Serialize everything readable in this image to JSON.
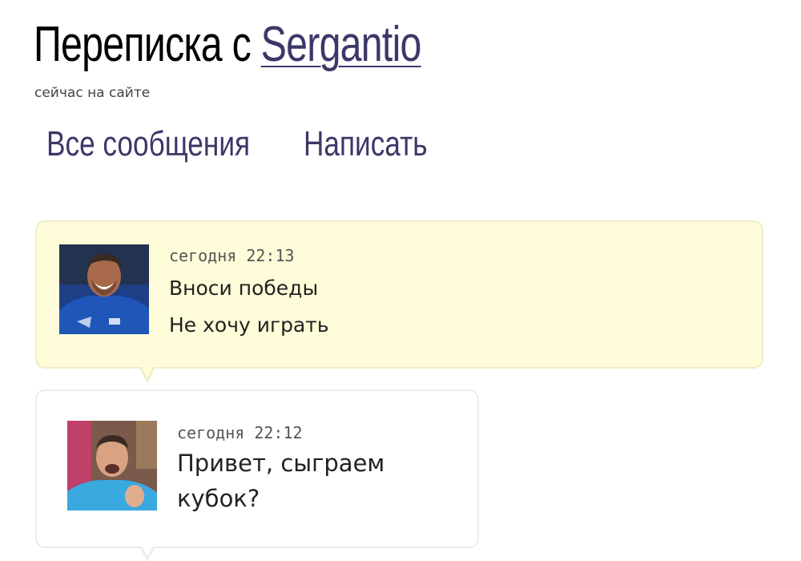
{
  "header": {
    "title_prefix": "Переписка с",
    "username": "Sergantio",
    "online_status": "сейчас на сайте"
  },
  "tabs": [
    {
      "label": "Все сообщения"
    },
    {
      "label": "Написать"
    }
  ],
  "messages": [
    {
      "direction": "incoming",
      "timestamp": "сегодня 22:13",
      "lines": [
        "Вноси победы",
        "Не хочу играть"
      ],
      "bubble_color": "#fefcd9"
    },
    {
      "direction": "outgoing",
      "timestamp": "сегодня 22:12",
      "lines": [
        "Привет, сыграем",
        "кубок?"
      ],
      "bubble_color": "#ffffff"
    }
  ],
  "colors": {
    "link": "#3b3869",
    "text": "#222222",
    "muted": "#555555"
  }
}
